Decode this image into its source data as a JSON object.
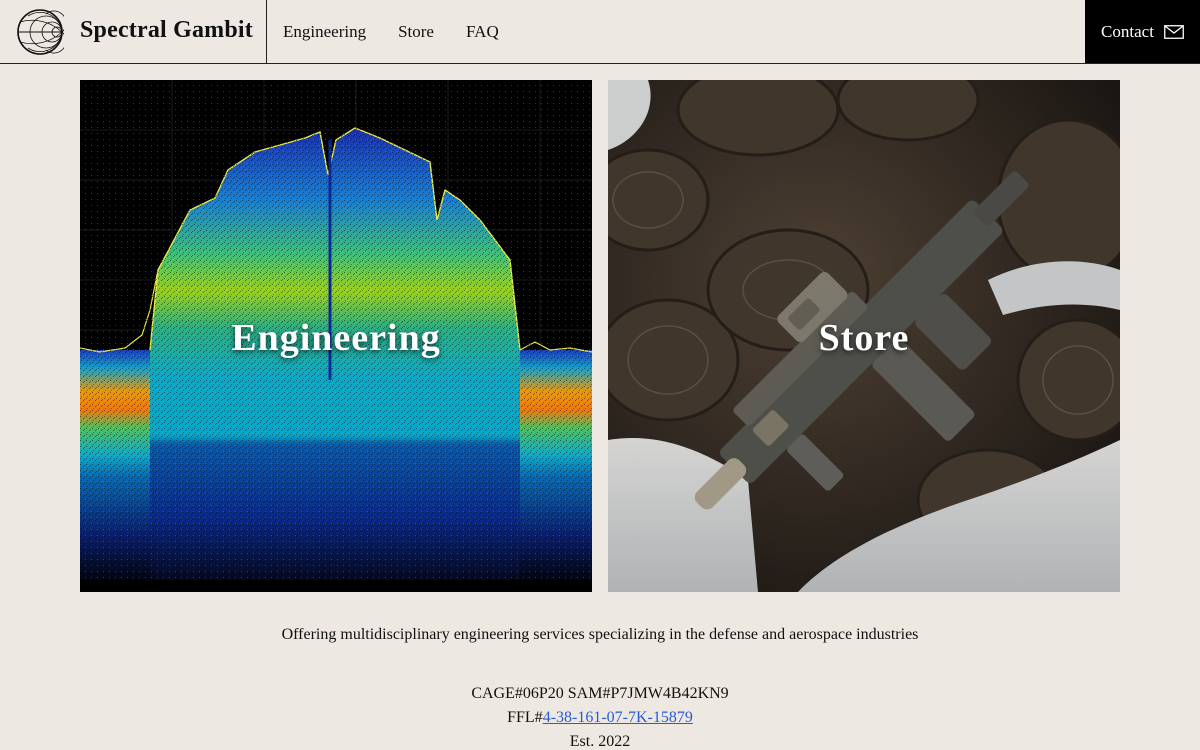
{
  "header": {
    "brand_name": "Spectral Gambit",
    "logo_icon": "smith-chart-logo-icon",
    "nav": [
      {
        "label": "Engineering"
      },
      {
        "label": "Store"
      },
      {
        "label": "FAQ"
      }
    ],
    "contact_label": "Contact",
    "contact_icon": "mail-icon"
  },
  "tiles": {
    "engineering_label": "Engineering",
    "store_label": "Store"
  },
  "footer": {
    "tagline": "Offering multidisciplinary engineering services specializing in the defense and aerospace industries",
    "cage_sam": "CAGE#06P20 SAM#P7JMW4B42KN9",
    "ffl_prefix": "FFL#",
    "ffl_number": "4-38-161-07-7K-15879",
    "established": "Est. 2022"
  },
  "colors": {
    "background": "#ede8e2",
    "contact_bg": "#000000",
    "link": "#2a5bd7"
  }
}
